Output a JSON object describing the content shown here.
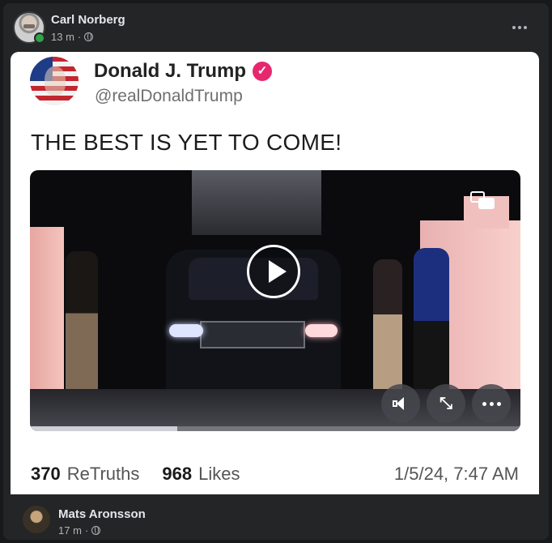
{
  "post": {
    "author": "Carl Norberg",
    "time": "13 m",
    "separator": "·",
    "privacy_icon": "globe-icon",
    "more_icon": "more-horizontal-icon"
  },
  "truth_card": {
    "display_name": "Donald J. Trump",
    "verified_icon": "verified-badge-icon",
    "verified_glyph": "✓",
    "handle": "@realDonaldTrump",
    "text": "THE BEST IS YET TO COME!",
    "video": {
      "progress_fraction": 0.3,
      "controls": [
        "play-icon",
        "picture-in-picture-icon",
        "volume-icon",
        "fullscreen-icon",
        "more-options-icon"
      ],
      "expand_glyph": "⤡"
    },
    "retruths_count": "370",
    "retruths_label": "ReTruths",
    "likes_count": "968",
    "likes_label": "Likes",
    "date": "1/5/24, 7:47 AM"
  },
  "comment": {
    "author": "Mats Aronsson",
    "time": "17 m",
    "separator": "·",
    "privacy_icon": "globe-icon"
  },
  "colors": {
    "background": "#18191a",
    "post_bg": "#242526",
    "text_primary": "#e4e6eb",
    "text_secondary": "#b0b3b8",
    "online": "#31a24c",
    "verified": "#e6286f"
  }
}
